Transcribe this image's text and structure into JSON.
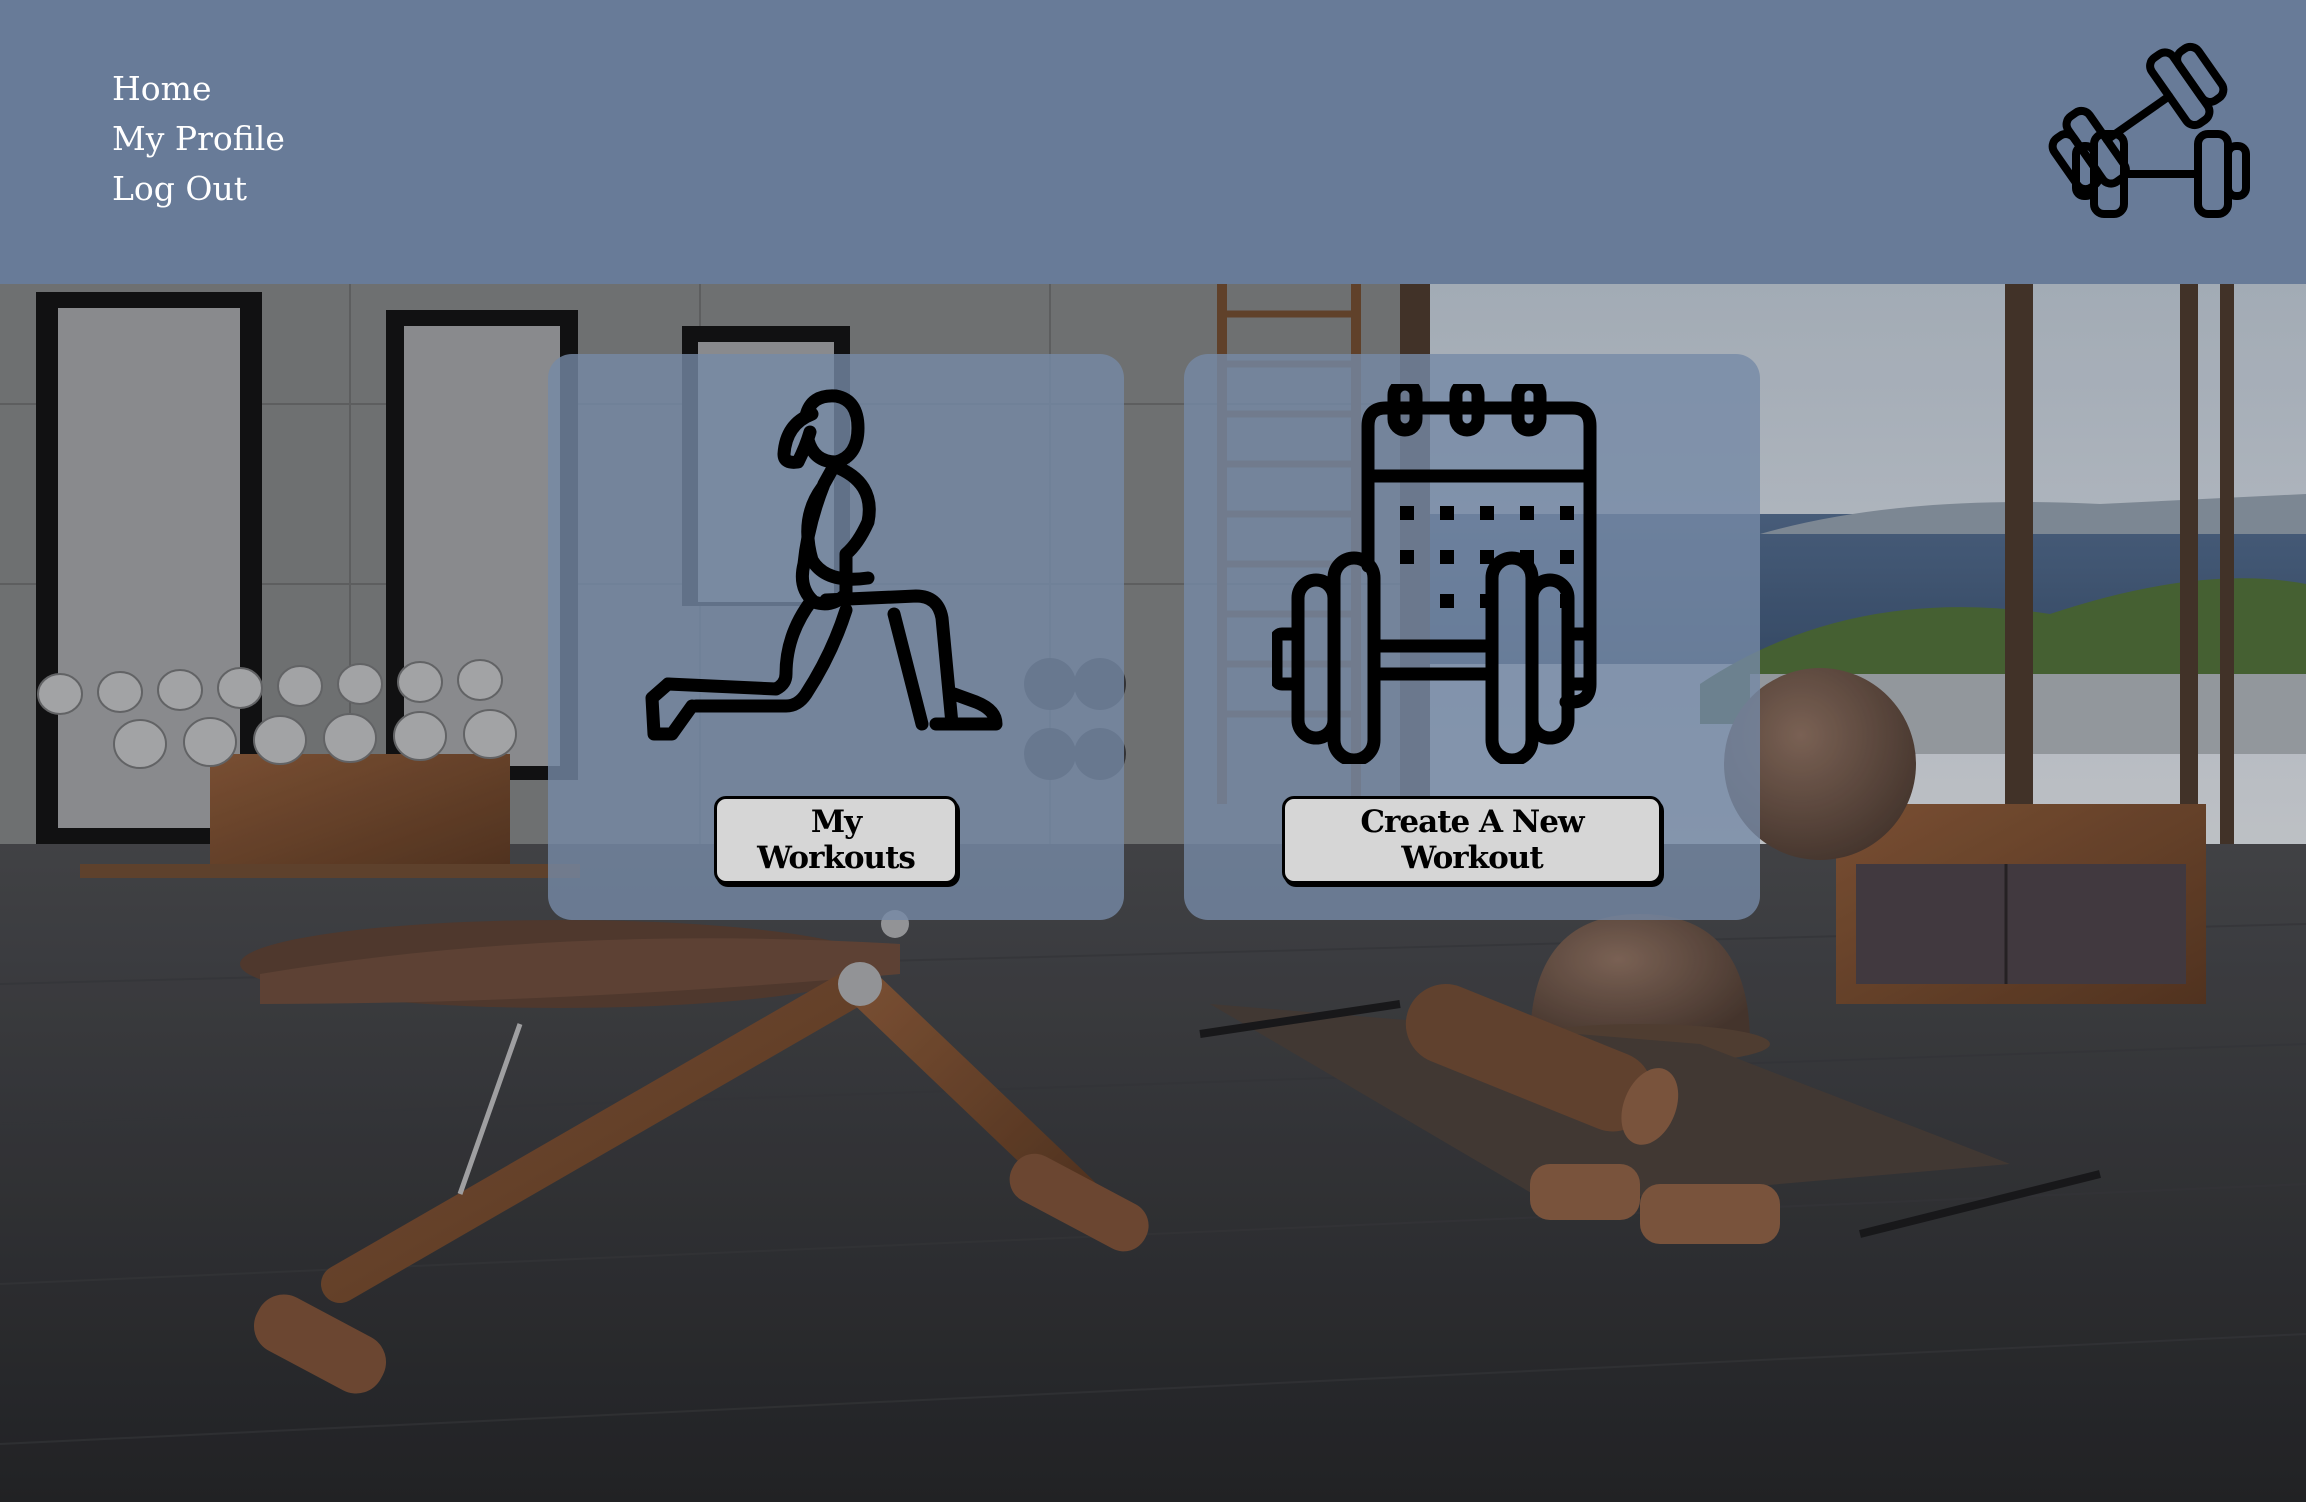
{
  "nav": {
    "home": "Home",
    "profile": "My Profile",
    "logout": "Log Out"
  },
  "logo": {
    "icon": "dumbbells-icon"
  },
  "cards": [
    {
      "icon": "lunge-exercise-icon",
      "button_label": "My Workouts"
    },
    {
      "icon": "calendar-dumbbell-icon",
      "button_label": "Create A New Workout"
    }
  ],
  "colors": {
    "header": "#687b98",
    "card_overlay": "#7689a6",
    "button": "#d6d6d6",
    "icon_stroke": "#000000",
    "nav_text": "#ffffff"
  }
}
